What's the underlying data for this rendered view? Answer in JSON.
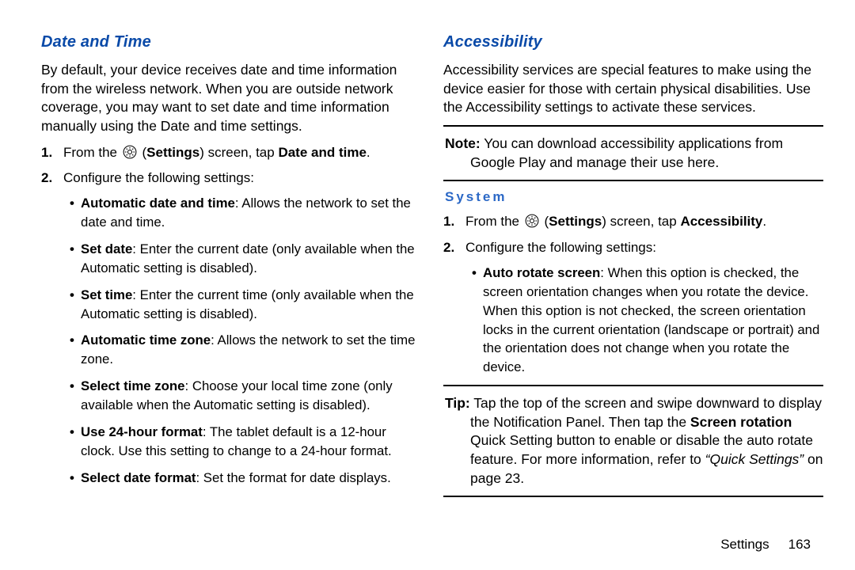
{
  "left": {
    "heading": "Date and Time",
    "intro": "By default, your device receives date and time information from the wireless network. When you are outside network coverage, you may want to set date and time information manually using the Date and time settings.",
    "step1_pre": "From the ",
    "step1_mid1": "(",
    "step1_settings": "Settings",
    "step1_mid2": ") screen, tap ",
    "step1_target": "Date and time",
    "step1_end": ".",
    "step2": "Configure the following settings:",
    "b1_label": "Automatic date and time",
    "b1_text": ": Allows the network to set the date and time.",
    "b2_label": "Set date",
    "b2_text": ": Enter the current date (only available when the Automatic setting is disabled).",
    "b3_label": "Set time",
    "b3_text": ": Enter the current time (only available when the Automatic setting is disabled).",
    "b4_label": "Automatic time zone",
    "b4_text": ": Allows the network to set the time zone.",
    "b5_label": "Select time zone",
    "b5_text": ": Choose your local time zone (only available when the Automatic setting is disabled).",
    "b6_label": "Use 24-hour format",
    "b6_text": ": The tablet default is a 12-hour clock. Use this setting to change to a 24-hour format.",
    "b7_label": "Select date format",
    "b7_text": ": Set the format for date displays."
  },
  "right": {
    "heading": "Accessibility",
    "intro": "Accessibility services are special features to make using the device easier for those with certain physical disabilities. Use the Accessibility settings to activate these services.",
    "note_lead": "Note:",
    "note_body": " You can download accessibility applications from Google Play and manage their use here.",
    "sub": "System",
    "step1_pre": "From the ",
    "step1_mid1": "(",
    "step1_settings": "Settings",
    "step1_mid2": ") screen, tap ",
    "step1_target": "Accessibility",
    "step1_end": ".",
    "step2": "Configure the following settings:",
    "b1_label": "Auto rotate screen",
    "b1_text": ": When this option is checked, the screen orientation changes when you rotate the device. When this option is not checked, the screen orientation locks in the current orientation (landscape or portrait) and the orientation does not change when you rotate the device.",
    "tip_lead": "Tip:",
    "tip_body_a": " Tap the top of the screen and swipe downward to display the Notification Panel. Then tap the ",
    "tip_bold": "Screen rotation",
    "tip_body_b": " Quick Setting button to enable or disable the auto rotate feature. For more information, refer to ",
    "tip_xref": "“Quick Settings”",
    "tip_body_c": " on page 23."
  },
  "footer": {
    "section": "Settings",
    "page": "163"
  }
}
